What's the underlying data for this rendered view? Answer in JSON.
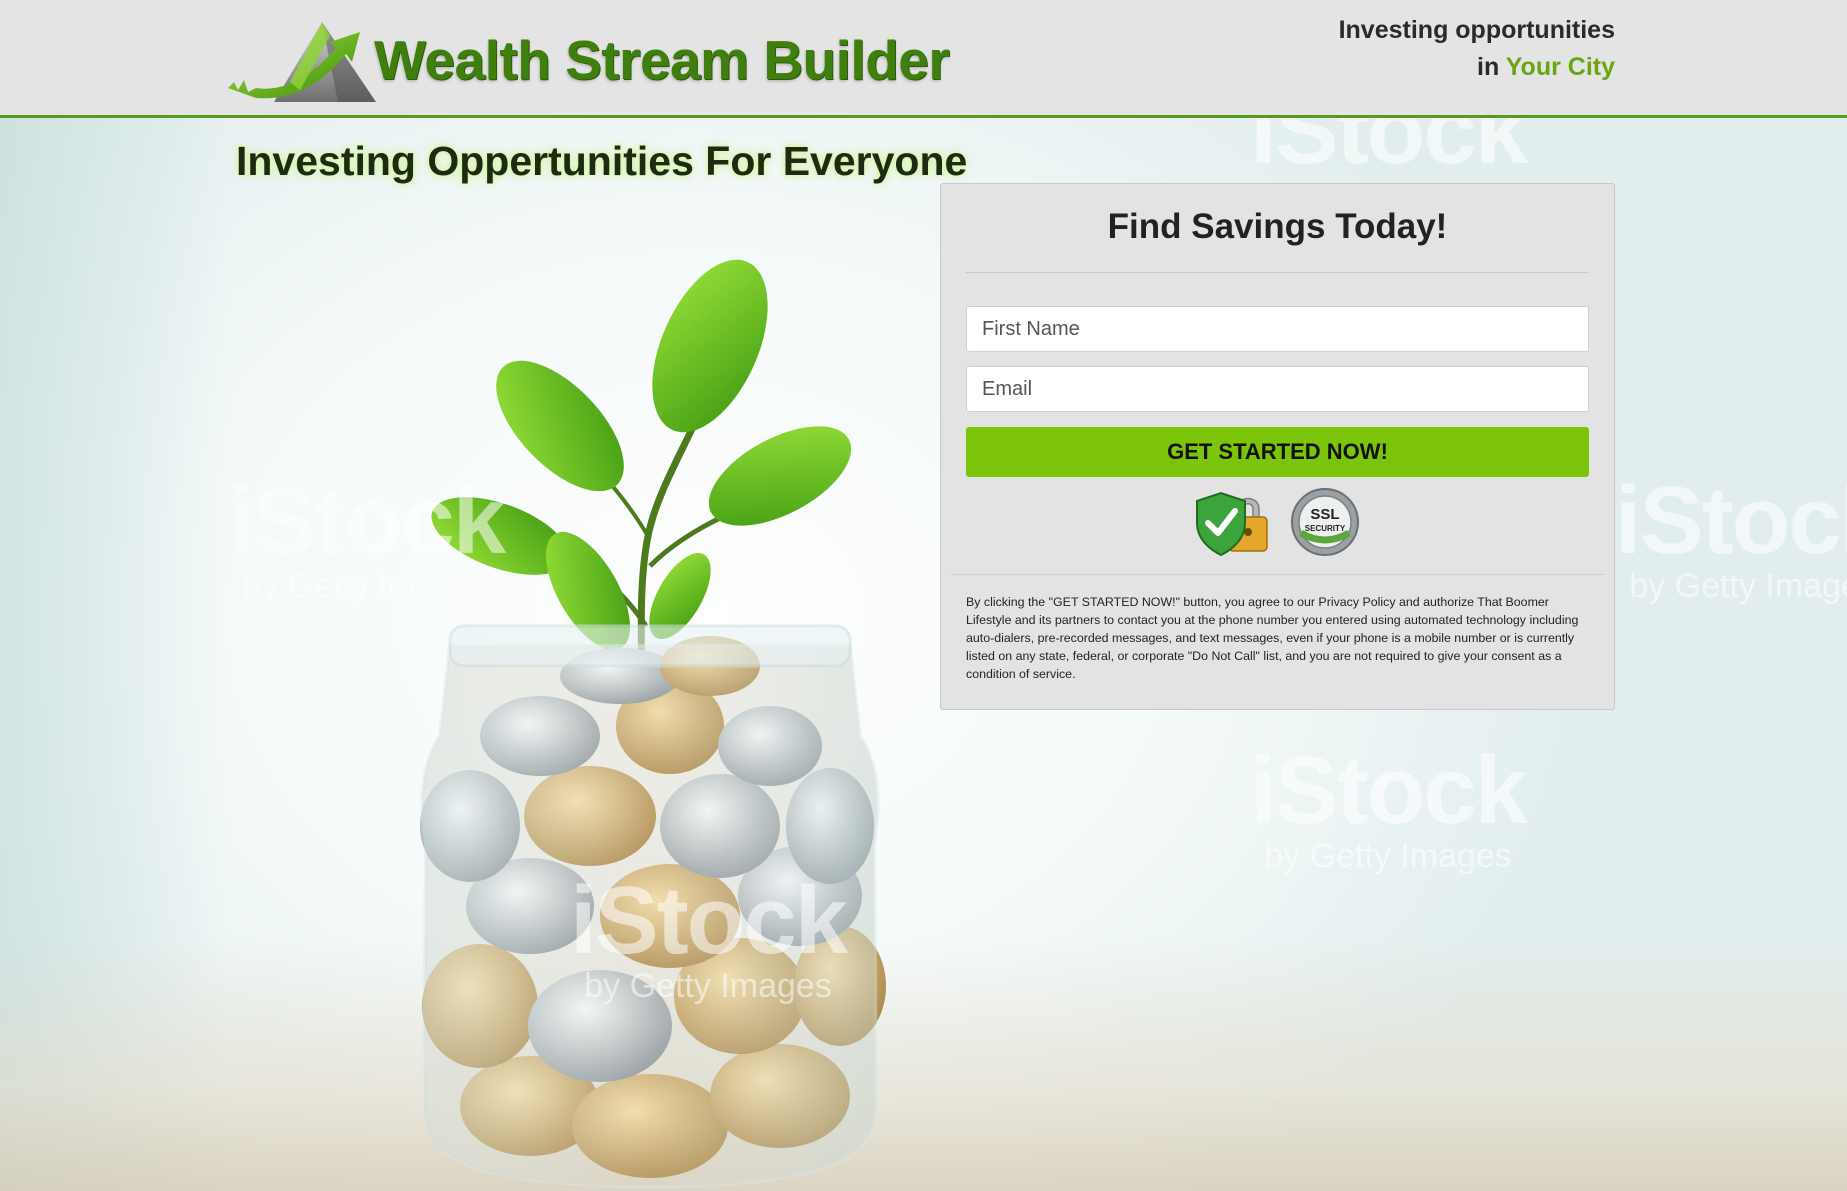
{
  "header": {
    "logo_text": "Wealth Stream Builder",
    "tagline_line1": "Investing opportunities",
    "tagline_in": "in",
    "tagline_city": "Your City"
  },
  "hero": {
    "title": "Investing Oppertunities For Everyone",
    "watermark_brand": "iStock",
    "watermark_sub": "by Getty Images"
  },
  "form": {
    "title": "Find Savings Today!",
    "first_name_placeholder": "First Name",
    "email_placeholder": "Email",
    "cta_label": "GET STARTED NOW!",
    "ssl_badge_line1": "SSL",
    "ssl_badge_line2": "SECURITY",
    "legal": "By clicking the \"GET STARTED NOW!\" button, you agree to our Privacy Policy and authorize That Boomer Lifestyle and its partners to contact you at the phone number you entered using automated technology including auto-dialers, pre-recorded messages, and text messages, even if your phone is a mobile number or is currently listed on any state, federal, or corporate \"Do Not Call\" list, and you are not required to give your consent as a condition of service."
  },
  "colors": {
    "brand_green": "#3f7f0e",
    "accent_green": "#6aa512",
    "cta_green": "#7cc40a",
    "header_bg": "#e4e4e4",
    "card_bg": "#e3e3e3"
  }
}
